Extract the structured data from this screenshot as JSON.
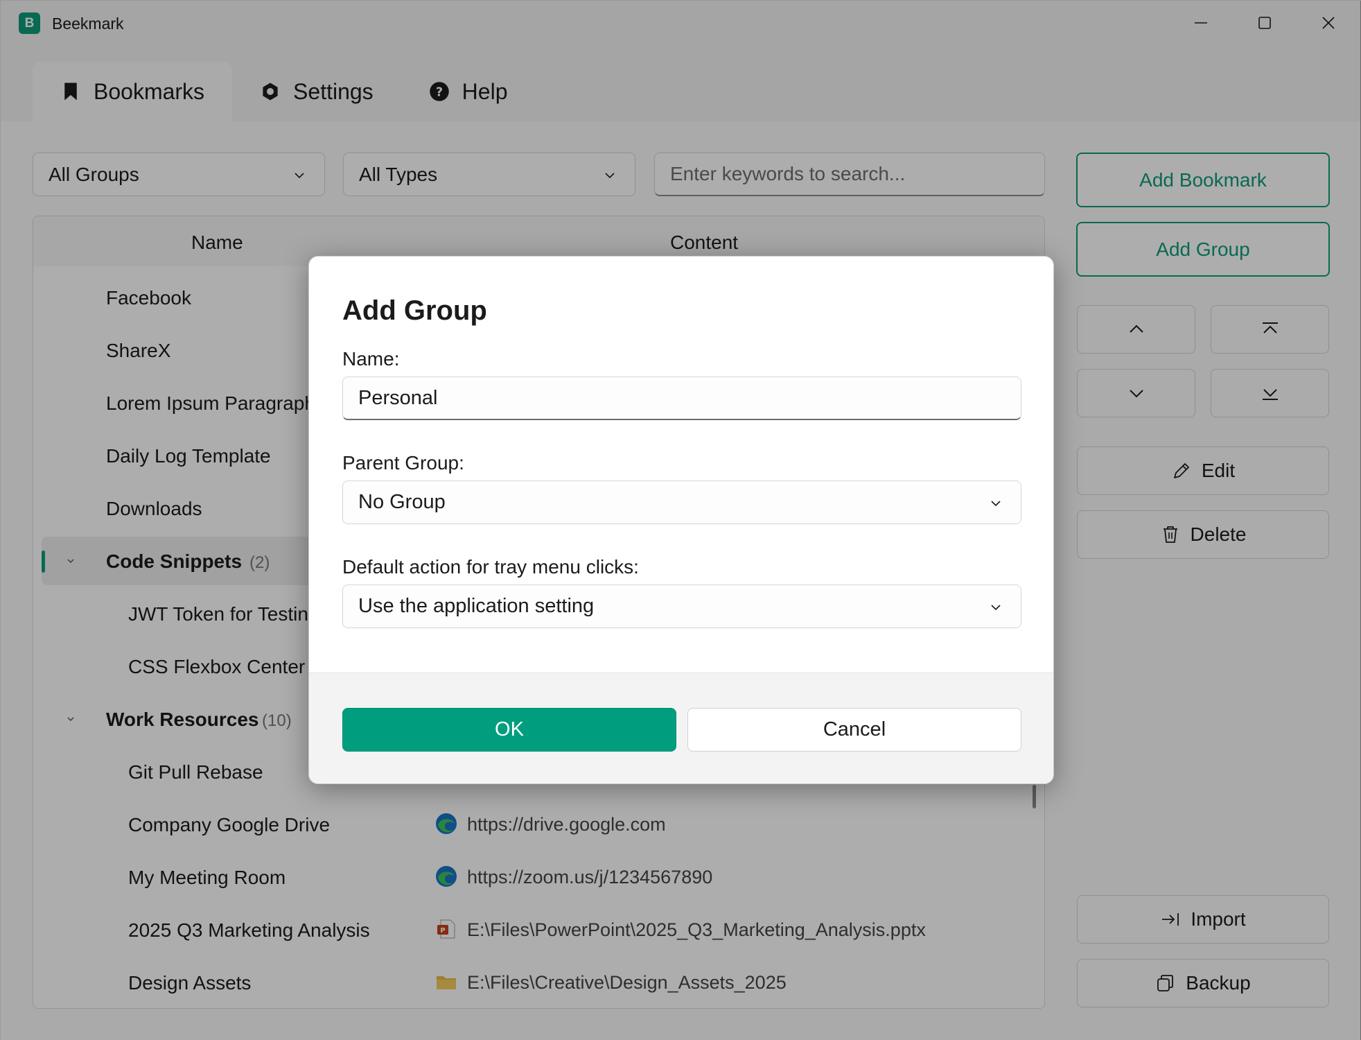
{
  "app": {
    "title": "Beekmark",
    "logo_letter": "B"
  },
  "tabs": [
    {
      "label": "Bookmarks",
      "icon": "bookmark-icon",
      "active": true
    },
    {
      "label": "Settings",
      "icon": "gear-icon",
      "active": false
    },
    {
      "label": "Help",
      "icon": "help-icon",
      "active": false
    }
  ],
  "toolbar": {
    "group_filter": "All Groups",
    "type_filter": "All Types",
    "search_placeholder": "Enter keywords to search..."
  },
  "table": {
    "headers": {
      "name": "Name",
      "content": "Content"
    },
    "rows": [
      {
        "name": "Facebook"
      },
      {
        "name": "ShareX"
      },
      {
        "name": "Lorem Ipsum Paragraph"
      },
      {
        "name": "Daily Log Template"
      },
      {
        "name": "Downloads"
      },
      {
        "name": "Code Snippets",
        "count": "(2)"
      },
      {
        "name": "JWT Token for Testing"
      },
      {
        "name": "CSS Flexbox Center"
      },
      {
        "name": "Work Resources",
        "count": "(10)"
      },
      {
        "name": "Git Pull Rebase"
      },
      {
        "name": "Company Google Drive",
        "content": "https://drive.google.com",
        "icon": "edge-browser-icon"
      },
      {
        "name": "My Meeting Room",
        "content": "https://zoom.us/j/1234567890",
        "icon": "edge-browser-icon"
      },
      {
        "name": "2025 Q3 Marketing Analysis",
        "content": "E:\\Files\\PowerPoint\\2025_Q3_Marketing_Analysis.pptx",
        "icon": "powerpoint-file-icon"
      },
      {
        "name": "Design Assets",
        "content": "E:\\Files\\Creative\\Design_Assets_2025",
        "icon": "folder-icon"
      }
    ]
  },
  "side": {
    "add_bookmark": "Add Bookmark",
    "add_group": "Add Group",
    "edit": "Edit",
    "delete": "Delete",
    "import": "Import",
    "backup": "Backup"
  },
  "dialog": {
    "title": "Add Group",
    "name_label": "Name:",
    "name_value": "Personal",
    "parent_label": "Parent Group:",
    "parent_value": "No Group",
    "action_label": "Default action for tray menu clicks:",
    "action_value": "Use the application setting",
    "ok": "OK",
    "cancel": "Cancel"
  },
  "colors": {
    "accent": "#0f9b7a",
    "ok_button": "#009e7f"
  }
}
